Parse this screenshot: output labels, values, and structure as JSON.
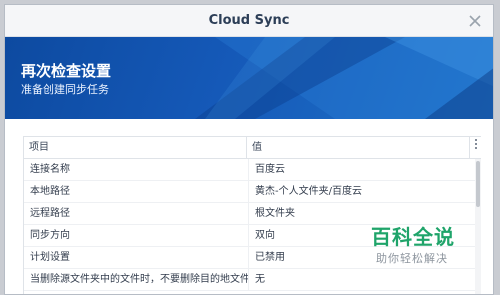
{
  "window": {
    "title": "Cloud Sync"
  },
  "header": {
    "title": "再次检查设置",
    "subtitle": "准备创建同步任务"
  },
  "table": {
    "columns": {
      "key": "项目",
      "value": "值"
    },
    "rows": [
      {
        "key": "连接名称",
        "value": "百度云"
      },
      {
        "key": "本地路径",
        "value": "黄杰-个人文件夹/百度云"
      },
      {
        "key": "远程路径",
        "value": "根文件夹"
      },
      {
        "key": "同步方向",
        "value": "双向"
      },
      {
        "key": "计划设置",
        "value": "已禁用"
      },
      {
        "key": "当删除源文件夹中的文件时，不要删除目的地文件...",
        "value": "无"
      }
    ]
  },
  "watermark": {
    "brand": "百科全说",
    "sub": "助你轻松解决"
  },
  "icons": {
    "close": "close-icon",
    "column_menu": "column-menu-icon"
  },
  "colors": {
    "header_dark": "#0d4aa0",
    "header_light": "#1f73c9",
    "watermark_green": "#1fa46a"
  }
}
